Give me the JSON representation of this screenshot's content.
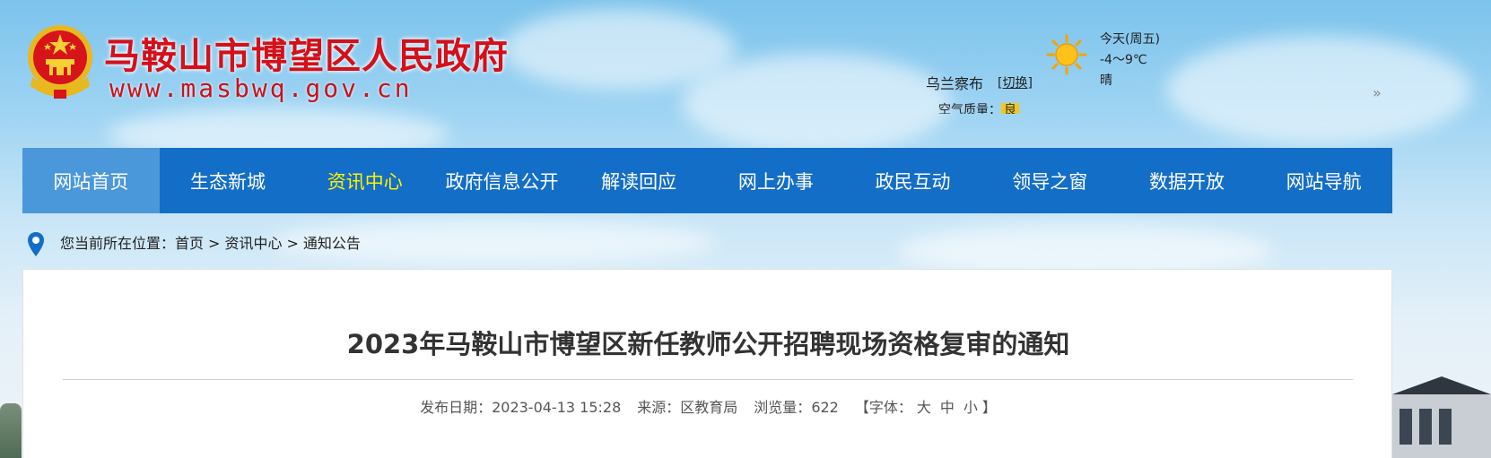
{
  "header": {
    "title": "马鞍山市博望区人民政府",
    "url": "www.masbwq.gov.cn",
    "emblem_icon": "national-emblem-icon"
  },
  "weather": {
    "city": "乌兰察布",
    "switch_label": "[切换]",
    "air_quality_label": "空气质量：",
    "air_quality_value": "良",
    "day": "今天(周五)",
    "temperature": "-4～9℃",
    "condition": "晴",
    "icon": "sun-icon",
    "next_icon": "double-chevron-right-icon",
    "next_glyph": "»"
  },
  "nav": {
    "items": [
      {
        "label": "网站首页"
      },
      {
        "label": "生态新城"
      },
      {
        "label": "资讯中心"
      },
      {
        "label": "政府信息公开"
      },
      {
        "label": "解读回应"
      },
      {
        "label": "网上办事"
      },
      {
        "label": "政民互动"
      },
      {
        "label": "领导之窗"
      },
      {
        "label": "数据开放"
      },
      {
        "label": "网站导航"
      }
    ],
    "colors": {
      "bar": "#136ec8",
      "home_bg": "#4a98da",
      "active_text": "#fff200"
    }
  },
  "breadcrumb": {
    "prefix": "您当前所在位置：",
    "items": [
      "首页",
      "资讯中心",
      "通知公告"
    ],
    "separator": ">",
    "icon": "location-pin-icon"
  },
  "article": {
    "title": "2023年马鞍山市博望区新任教师公开招聘现场资格复审的通知",
    "date_label": "发布日期：",
    "date": "2023-04-13 15:28",
    "source_label": "来源：",
    "source": "区教育局",
    "views_label": "浏览量：",
    "views": "622",
    "font_open": "【字体：",
    "font_sizes": [
      "大",
      "中",
      "小"
    ],
    "font_close": "】"
  }
}
